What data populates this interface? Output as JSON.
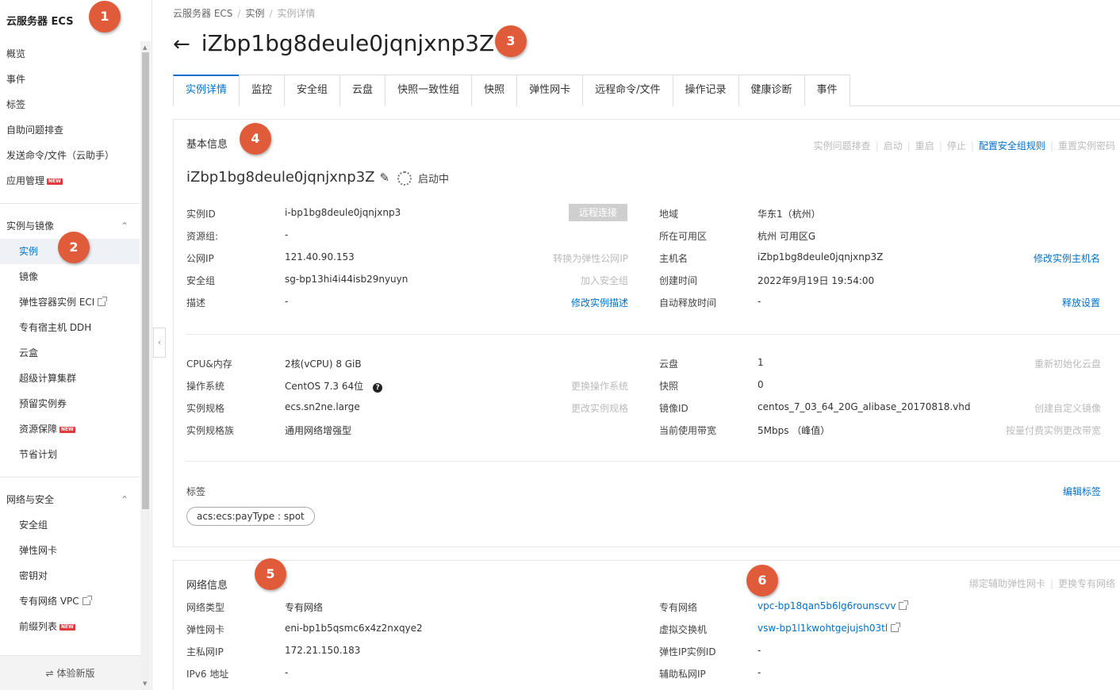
{
  "sidebar": {
    "brand": "云服务器 ECS",
    "top_items": [
      "概览",
      "事件",
      "标签",
      "自助问题排查",
      "发送命令/文件（云助手）",
      "应用管理"
    ],
    "new_badge": "NEW",
    "group1": {
      "title": "实例与镜像",
      "items": [
        "实例",
        "镜像",
        "弹性容器实例 ECI",
        "专有宿主机 DDH",
        "云盒",
        "超级计算集群",
        "预留实例券",
        "资源保障",
        "节省计划"
      ]
    },
    "group2": {
      "title": "网络与安全",
      "items": [
        "安全组",
        "弹性网卡",
        "密钥对",
        "专有网络 VPC",
        "前缀列表"
      ]
    },
    "footer": "体验新版"
  },
  "breadcrumb": [
    "云服务器 ECS",
    "实例",
    "实例详情"
  ],
  "title": "iZbp1bg8deule0jqnjxnp3Z",
  "tabs": [
    "实例详情",
    "监控",
    "安全组",
    "云盘",
    "快照一致性组",
    "快照",
    "弹性网卡",
    "远程命令/文件",
    "操作记录",
    "健康诊断",
    "事件"
  ],
  "basic": {
    "title": "基本信息",
    "actions": [
      "实例问题排查",
      "启动",
      "重启",
      "停止",
      "配置安全组规则",
      "重置实例密码"
    ],
    "instance_name": "iZbp1bg8deule0jqnjxnp3Z",
    "status": "启动中",
    "remote_connect": "远程连接",
    "left_rows": [
      {
        "label": "实例ID",
        "value": "i-bp1bg8deule0jqnjxnp3",
        "action": ""
      },
      {
        "label": "资源组:",
        "value": "-",
        "action": ""
      },
      {
        "label": "公网IP",
        "value": "121.40.90.153",
        "action": "转换为弹性公网IP"
      },
      {
        "label": "安全组",
        "value": "sg-bp13hi4i44isb29nyuyn",
        "action": "加入安全组"
      },
      {
        "label": "描述",
        "value": "-",
        "action": "修改实例描述"
      }
    ],
    "right_rows": [
      {
        "label": "地域",
        "value": "华东1（杭州）",
        "action": ""
      },
      {
        "label": "所在可用区",
        "value": "杭州 可用区G",
        "action": ""
      },
      {
        "label": "主机名",
        "value": "iZbp1bg8deule0jqnjxnp3Z",
        "action": "修改实例主机名"
      },
      {
        "label": "创建时间",
        "value": "2022年9月19日 19:54:00",
        "action": ""
      },
      {
        "label": "自动释放时间",
        "value": "-",
        "action": "释放设置"
      }
    ],
    "left_rows2": [
      {
        "label": "CPU&内存",
        "value": "2核(vCPU) 8 GiB",
        "action": ""
      },
      {
        "label": "操作系统",
        "value": "CentOS 7.3 64位",
        "action": "更换操作系统"
      },
      {
        "label": "实例规格",
        "value": "ecs.sn2ne.large",
        "action": "更改实例规格"
      },
      {
        "label": "实例规格族",
        "value": "通用网络增强型",
        "action": ""
      }
    ],
    "right_rows2": [
      {
        "label": "云盘",
        "value": "1",
        "action": "重新初始化云盘"
      },
      {
        "label": "快照",
        "value": "0",
        "action": ""
      },
      {
        "label": "镜像ID",
        "value": "centos_7_03_64_20G_alibase_20170818.vhd",
        "action": "创建自定义镜像"
      },
      {
        "label": "当前使用带宽",
        "value": "5Mbps （峰值）",
        "action": "按量付费实例更改带宽"
      }
    ],
    "tags_label": "标签",
    "edit_tags": "编辑标签",
    "tag_value": "acs:ecs:payType : spot"
  },
  "network": {
    "title": "网络信息",
    "actions": [
      "绑定辅助弹性网卡",
      "更换专有网络"
    ],
    "left_rows": [
      {
        "label": "网络类型",
        "value": "专有网络"
      },
      {
        "label": "弹性网卡",
        "value": "eni-bp1b5qsmc6x4z2nxqye2"
      },
      {
        "label": "主私网IP",
        "value": "172.21.150.183"
      },
      {
        "label": "IPv6 地址",
        "value": "-"
      }
    ],
    "right_rows": [
      {
        "label": "专有网络",
        "value": "vpc-bp18qan5b6lg6rounscvv"
      },
      {
        "label": "虚拟交换机",
        "value": "vsw-bp1l1kwohtgejujsh03tl"
      },
      {
        "label": "弹性IP实例ID",
        "value": "-"
      },
      {
        "label": "辅助私网IP",
        "value": "-"
      }
    ]
  },
  "markers": [
    "1",
    "2",
    "3",
    "4",
    "5",
    "6"
  ],
  "colors": {
    "accent": "#0070cc",
    "marker": "#df5b39",
    "badge": "#e4393c"
  },
  "icons": [
    "back-arrow-icon",
    "edit-icon",
    "loading-spinner-icon",
    "help-icon",
    "external-link-icon",
    "chevron-up-icon",
    "collapse-left-icon",
    "switch-icon"
  ]
}
